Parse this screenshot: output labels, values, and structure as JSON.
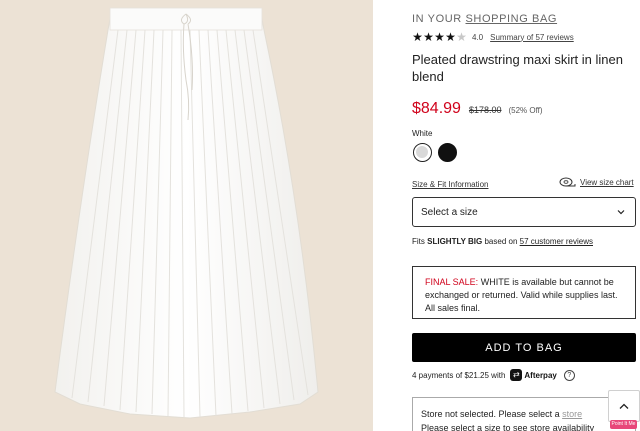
{
  "header": {
    "prefix": "IN YOUR",
    "bag_link": "SHOPPING BAG"
  },
  "rating": {
    "stars": 4,
    "max_stars": 5,
    "value": "4.0",
    "summary_link": "Summary of 57 reviews"
  },
  "product": {
    "title": "Pleated drawstring maxi skirt in linen blend",
    "price_sale": "$84.99",
    "price_original": "$178.00",
    "discount": "(52% Off)",
    "color_label": "White",
    "swatches": [
      {
        "name": "White",
        "color": "#ffffff",
        "selected": true
      },
      {
        "name": "Black",
        "color": "#111111",
        "selected": false
      }
    ]
  },
  "size": {
    "fit_info_link": "Size & Fit Information",
    "chart_link": "View size chart",
    "select_placeholder": "Select a size"
  },
  "fit": {
    "prefix": "Fits",
    "verdict": "SLIGHTLY BIG",
    "middle": "based on",
    "reviews_link": "57 customer reviews"
  },
  "final_sale": {
    "label": "FINAL SALE:",
    "text": "WHITE is available but cannot be exchanged or returned. Valid while supplies last. All sales final."
  },
  "cta": {
    "add_to_bag": "ADD TO BAG"
  },
  "afterpay": {
    "text": "4 payments of $21.25 with",
    "brand": "Afterpay",
    "info": "?"
  },
  "store": {
    "line1": "Store not selected. Please select a",
    "link": "store",
    "line2": "Please select a size to see store availability"
  },
  "badge": {
    "text": "Point It Me"
  },
  "colors": {
    "sale_red": "#d0021b",
    "button_black": "#000000",
    "image_bg": "#ece2d5"
  }
}
